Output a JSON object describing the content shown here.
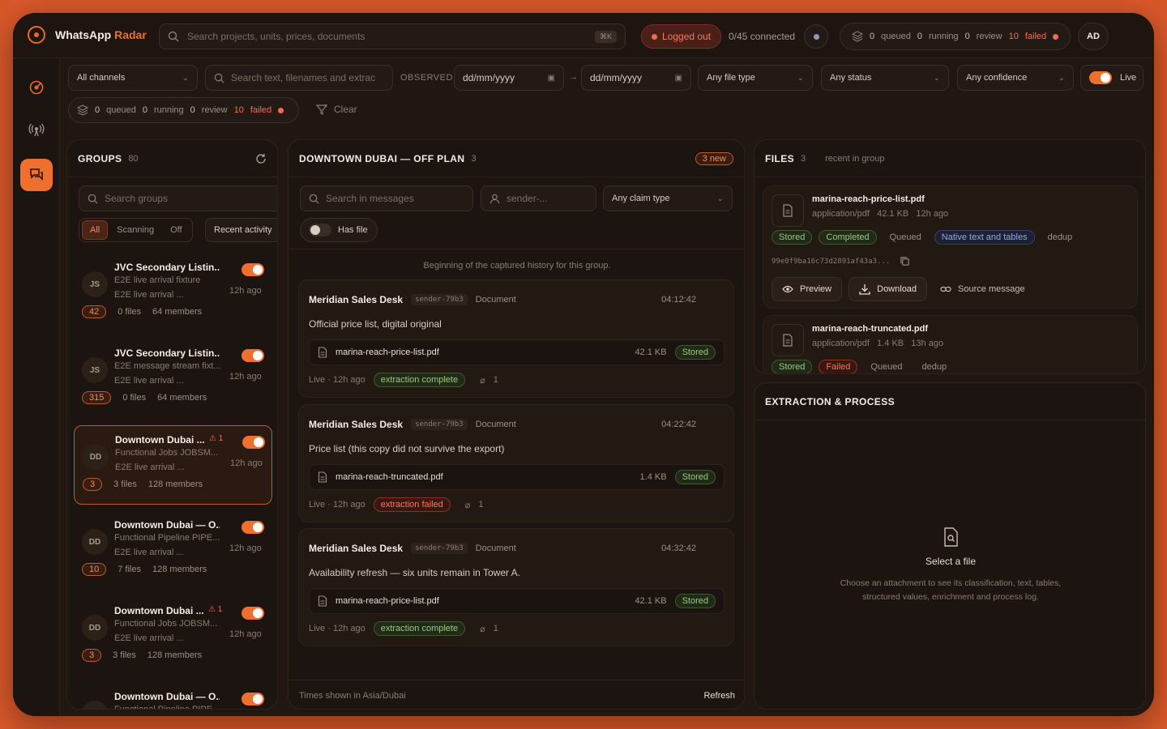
{
  "app": {
    "name_prefix": "WhatsApp",
    "name_suffix": "Radar"
  },
  "search": {
    "placeholder": "Search projects, units, prices, documents",
    "shortcut": "⌘K"
  },
  "status": {
    "logged_out": "Logged out",
    "connected": "0/45 connected"
  },
  "queue": {
    "queued_v": "0",
    "queued": "queued",
    "running_v": "0",
    "running": "running",
    "review_v": "0",
    "review": "review",
    "failed_v": "10",
    "failed": "failed"
  },
  "user": {
    "initials": "AD"
  },
  "filters": {
    "channels": "All channels",
    "text_search": "Search text, filenames and extrac",
    "observed": "OBSERVED",
    "date_from": "dd/mm/yyyy",
    "date_to": "dd/mm/yyyy",
    "file_type": "Any file type",
    "status": "Any status",
    "confidence": "Any confidence",
    "live": "Live",
    "clear": "Clear"
  },
  "groups": {
    "title": "GROUPS",
    "count": "80",
    "search_placeholder": "Search groups",
    "seg": [
      "All",
      "Scanning",
      "Off"
    ],
    "sort": "Recent activity",
    "items": [
      {
        "initials": "JS",
        "name": "JVC Secondary Listin...",
        "sub1": "E2E live arrival fixture",
        "sub2": "E2E live arrival ...",
        "time": "12h ago",
        "badge": "42",
        "files": "0 files",
        "members": "64 members",
        "warn": ""
      },
      {
        "initials": "JS",
        "name": "JVC Secondary Listin...",
        "sub1": "E2E message stream fixt...",
        "sub2": "E2E live arrival ...",
        "time": "12h ago",
        "badge": "315",
        "files": "0 files",
        "members": "64 members",
        "warn": ""
      },
      {
        "initials": "DD",
        "name": "Downtown Dubai ...",
        "sub1": "Functional Jobs JOBSM...",
        "sub2": "E2E live arrival ...",
        "time": "12h ago",
        "badge": "3",
        "files": "3 files",
        "members": "128 members",
        "warn": "⚠ 1"
      },
      {
        "initials": "DD",
        "name": "Downtown Dubai — O...",
        "sub1": "Functional Pipeline PIPE...",
        "sub2": "E2E live arrival ...",
        "time": "12h ago",
        "badge": "10",
        "files": "7 files",
        "members": "128 members",
        "warn": ""
      },
      {
        "initials": "DD",
        "name": "Downtown Dubai ...",
        "sub1": "Functional Jobs JOBSM...",
        "sub2": "E2E live arrival ...",
        "time": "12h ago",
        "badge": "3",
        "files": "3 files",
        "members": "128 members",
        "warn": "⚠ 1"
      },
      {
        "initials": "DD",
        "name": "Downtown Dubai — O...",
        "sub1": "Functional Pipeline PIPE...",
        "sub2": "",
        "time": "",
        "badge": "",
        "files": "",
        "members": "",
        "warn": ""
      }
    ]
  },
  "chat": {
    "title": "DOWNTOWN DUBAI — OFF PLAN",
    "count": "3",
    "new": "3 new",
    "search_placeholder": "Search in messages",
    "sender_placeholder": "sender-...",
    "claim": "Any claim type",
    "has_file": "Has file",
    "beginning": "Beginning of the captured history for this group.",
    "messages": [
      {
        "sender": "Meridian Sales Desk",
        "id": "sender-79b3",
        "type": "Document",
        "time": "04:12:42",
        "body": "Official price list, digital original",
        "file": "marina-reach-price-list.pdf",
        "size": "42.1 KB",
        "stored": "Stored",
        "live": "Live · 12h ago",
        "status": "extraction complete",
        "att": "1"
      },
      {
        "sender": "Meridian Sales Desk",
        "id": "sender-79b3",
        "type": "Document",
        "time": "04:22:42",
        "body": "Price list (this copy did not survive the export)",
        "file": "marina-reach-truncated.pdf",
        "size": "1.4 KB",
        "stored": "Stored",
        "live": "Live · 12h ago",
        "status": "extraction failed",
        "att": "1"
      },
      {
        "sender": "Meridian Sales Desk",
        "id": "sender-79b3",
        "type": "Document",
        "time": "04:32:42",
        "body": "Availability refresh — six units remain in Tower A.",
        "file": "marina-reach-price-list.pdf",
        "size": "42.1 KB",
        "stored": "Stored",
        "live": "Live · 12h ago",
        "status": "extraction complete",
        "att": "1"
      }
    ],
    "tz": "Times shown in Asia/Dubai",
    "refresh": "Refresh"
  },
  "files": {
    "title": "FILES",
    "count": "3",
    "scope": "recent in group",
    "items": [
      {
        "name": "marina-reach-price-list.pdf",
        "meta": "application/pdf   42.1 KB   12h ago",
        "tags": [
          "Stored",
          "Completed",
          "Queued",
          "Native text and tables",
          "dedup"
        ],
        "hash": "99e0f9ba16c73d2891af43a3...",
        "preview": "Preview",
        "download": "Download",
        "source": "Source message"
      },
      {
        "name": "marina-reach-truncated.pdf",
        "meta": "application/pdf   1.4 KB   13h ago",
        "tags": [
          "Stored",
          "Failed",
          "Queued",
          "dedup"
        ]
      }
    ]
  },
  "extraction": {
    "title": "EXTRACTION & PROCESS",
    "empty_title": "Select a file",
    "empty_text1": "Choose an attachment to see its classification, text, tables,",
    "empty_text2": "structured values, enrichment and process log."
  },
  "colors": {
    "accent": "#ef6f2e",
    "background": "#d9582a",
    "success": "#9fc77f",
    "danger": "#ef7b5f"
  }
}
